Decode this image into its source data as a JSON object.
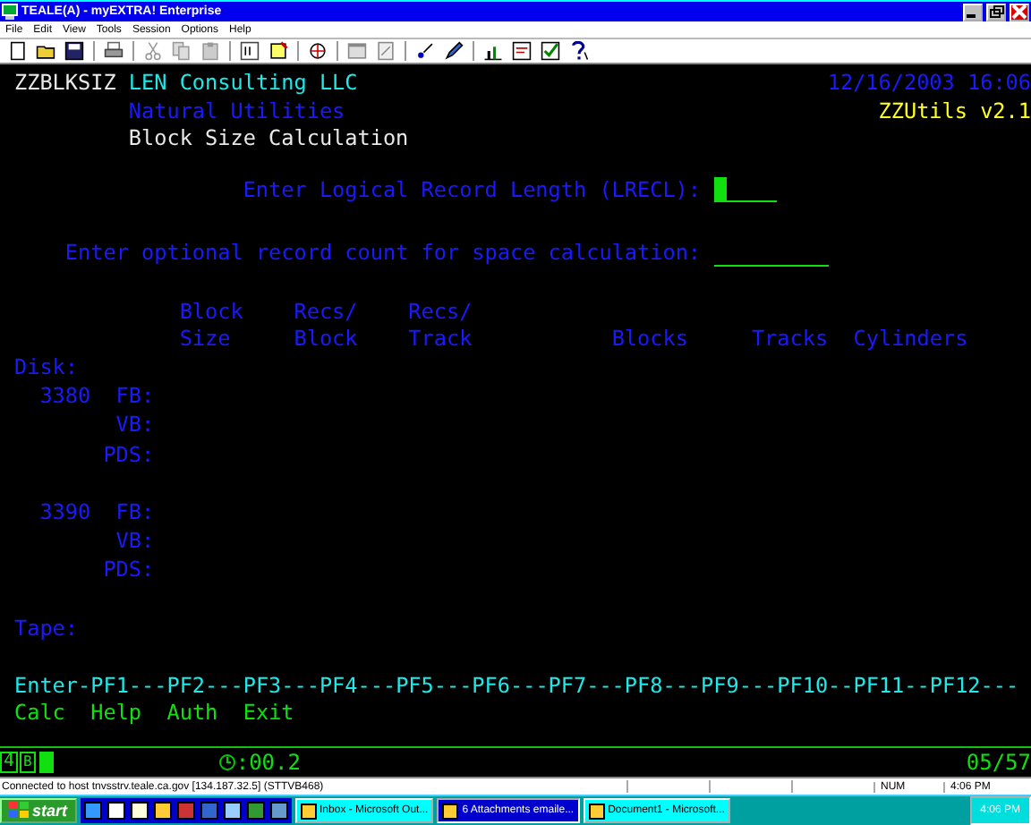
{
  "window": {
    "title": "TEALE(A) - myEXTRA! Enterprise"
  },
  "menu": [
    "File",
    "Edit",
    "View",
    "Tools",
    "Session",
    "Options",
    "Help"
  ],
  "header": {
    "program_id": "ZZBLKSIZ",
    "company": "LEN Consulting LLC",
    "date_time": "12/16/2003 16:06",
    "product": "Natural Utilities",
    "version": "ZZUtils v2.1",
    "title": "Block Size Calculation"
  },
  "prompts": [
    {
      "label": "Enter Logical Record Length (LRECL):",
      "cursor": true,
      "kind": "short"
    },
    {
      "label": "Enter optional record count for space calculation:",
      "cursor": false,
      "kind": "long"
    }
  ],
  "columns": [
    {
      "top": "Block",
      "bottom": "Size"
    },
    {
      "top": "Recs/",
      "bottom": "Block"
    },
    {
      "top": "Recs/",
      "bottom": "Track"
    },
    {
      "bottom": "Blocks"
    },
    {
      "bottom": "Tracks"
    },
    {
      "bottom": "Cylinders"
    }
  ],
  "groups": [
    {
      "label": "Disk:",
      "devices": [
        {
          "model": "3380",
          "formats": [
            "FB:",
            "VB:",
            "PDS:"
          ]
        },
        {
          "model": "3390",
          "formats": [
            "FB:",
            "VB:",
            "PDS:"
          ]
        }
      ]
    },
    {
      "label": "Tape:"
    }
  ],
  "pf_line": "Enter-PF1---PF2---PF3---PF4---PF5---PF6---PF7---PF8---PF9---PF10--PF11--PF12---",
  "pf_labels": [
    "Calc",
    "Help",
    "Auth",
    "Exit"
  ],
  "oia": {
    "screen": "4",
    "mode": "B",
    "timer": ":00.2",
    "position": "05/57"
  },
  "status_bar": {
    "text": "Connected to host tnvsstrv.teale.ca.gov [134.187.32.5] (STTVB468)",
    "num": "NUM",
    "time": "4:06 PM"
  },
  "taskbar": {
    "start": "start",
    "tasks": [
      {
        "label": "Inbox - Microsoft Out...",
        "selected": false
      },
      {
        "label": "6 Attachments emaile...",
        "selected": true
      },
      {
        "label": "Document1 - Microsoft...",
        "selected": false
      }
    ],
    "clock": "4:06 PM"
  }
}
